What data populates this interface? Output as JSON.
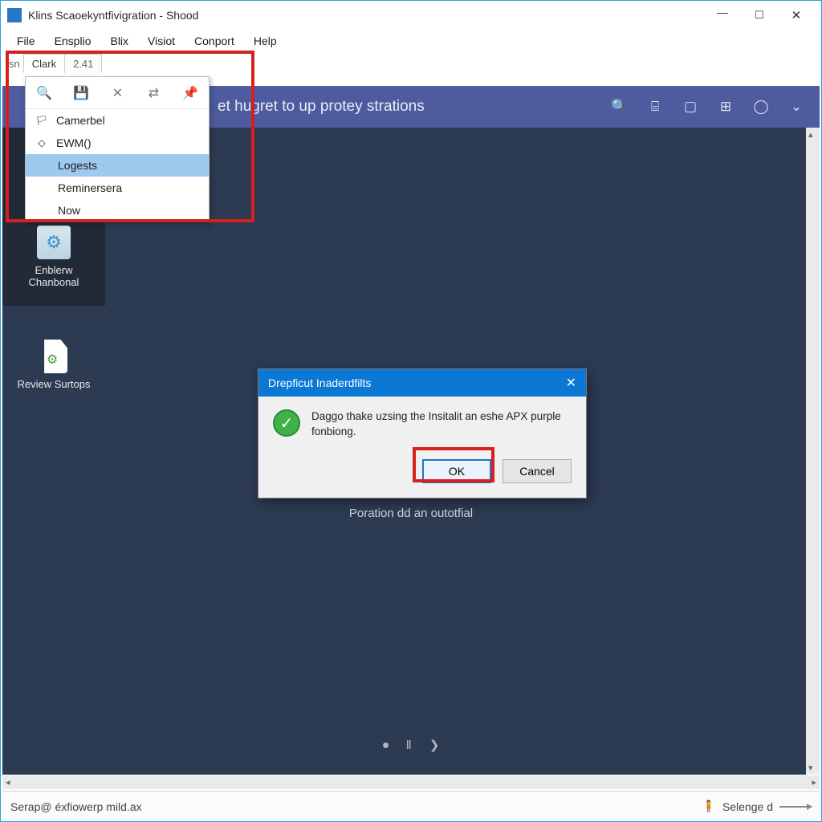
{
  "window": {
    "title": "Klins Scaoekyntfivigration - Shood"
  },
  "menubar": [
    "File",
    "Ensplio",
    "Blix",
    "Visiot",
    "Conport",
    "Help"
  ],
  "tabs": {
    "pre": "sn",
    "items": [
      {
        "label": "Clark",
        "active": true
      },
      {
        "label": "2.41",
        "active": false
      }
    ]
  },
  "purple_band": {
    "text": "et hugret to up protey strations"
  },
  "dropdown": {
    "toolbar_icons": [
      "search",
      "save",
      "close",
      "shuffle",
      "pin"
    ],
    "items": [
      {
        "icon": "flag",
        "label": "Camerbel",
        "selected": false,
        "indent": false
      },
      {
        "icon": "diamond",
        "label": "EWM()",
        "selected": false,
        "indent": false
      },
      {
        "icon": "",
        "label": "Logests",
        "selected": true,
        "indent": true
      },
      {
        "icon": "",
        "label": "Reminersera",
        "selected": false,
        "indent": true
      },
      {
        "icon": "",
        "label": "Now",
        "selected": false,
        "indent": true
      }
    ]
  },
  "desktop_icons": [
    {
      "label": "Enblerw Chanbonal"
    },
    {
      "label": "Review Surtops"
    }
  ],
  "modal": {
    "title": "Drepficut Inaderdfilts",
    "message": "Daggo thake uzsing the Insitalit an eshe APX purple fonbiong.",
    "ok": "OK",
    "cancel": "Cancel"
  },
  "subtitle": "Poration dd an outotfial",
  "statusbar": {
    "left": "Serap@ éxfiowerp mild.ax",
    "right": "Selenge d"
  }
}
